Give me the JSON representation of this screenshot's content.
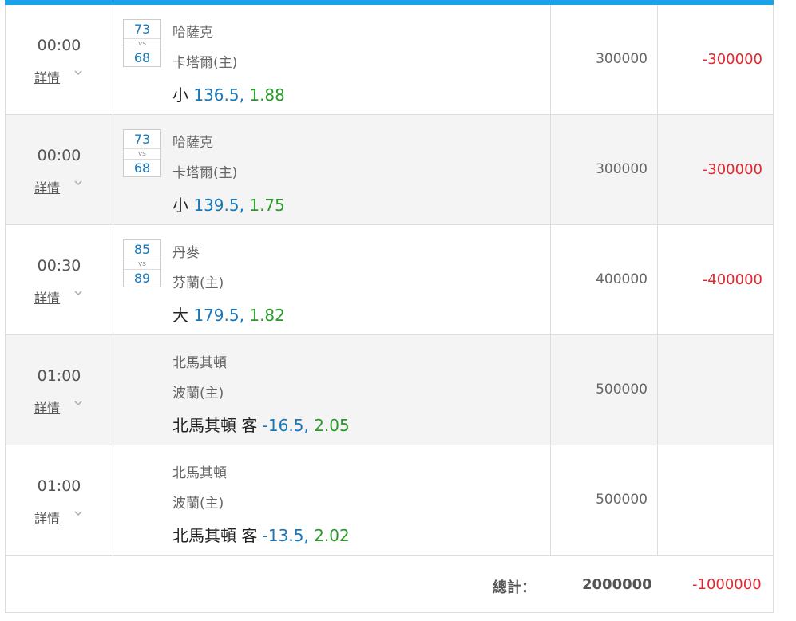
{
  "colors": {
    "accent": "#1aa3e8",
    "score": "#1a78b8",
    "odds": "#2a9a2a",
    "loss": "#e0282e"
  },
  "rows": [
    {
      "time": "00:00",
      "detail": "詳情",
      "score_a": "73",
      "vs": "vs",
      "score_b": "68",
      "team1": "哈薩克",
      "team2": "卡塔爾(主)",
      "bet_prefix": "小",
      "bet_line": "136.5",
      "bet_sep": ",",
      "bet_odds": "1.88",
      "stake": "300000",
      "result": "-300000"
    },
    {
      "time": "00:00",
      "detail": "詳情",
      "score_a": "73",
      "vs": "vs",
      "score_b": "68",
      "team1": "哈薩克",
      "team2": "卡塔爾(主)",
      "bet_prefix": "小",
      "bet_line": "139.5",
      "bet_sep": ",",
      "bet_odds": "1.75",
      "stake": "300000",
      "result": "-300000"
    },
    {
      "time": "00:30",
      "detail": "詳情",
      "score_a": "85",
      "vs": "vs",
      "score_b": "89",
      "team1": "丹麥",
      "team2": "芬蘭(主)",
      "bet_prefix": "大",
      "bet_line": "179.5",
      "bet_sep": ",",
      "bet_odds": "1.82",
      "stake": "400000",
      "result": "-400000"
    },
    {
      "time": "01:00",
      "detail": "詳情",
      "team1": "北馬其頓",
      "team2": "波蘭(主)",
      "bet_prefix": "北馬其頓 客",
      "bet_line": "-16.5",
      "bet_sep": ",",
      "bet_odds": "2.05",
      "stake": "500000",
      "result": ""
    },
    {
      "time": "01:00",
      "detail": "詳情",
      "team1": "北馬其頓",
      "team2": "波蘭(主)",
      "bet_prefix": "北馬其頓 客",
      "bet_line": "-13.5",
      "bet_sep": ",",
      "bet_odds": "2.02",
      "stake": "500000",
      "result": ""
    }
  ],
  "total": {
    "label": "總計：",
    "stake": "2000000",
    "result": "-1000000"
  }
}
